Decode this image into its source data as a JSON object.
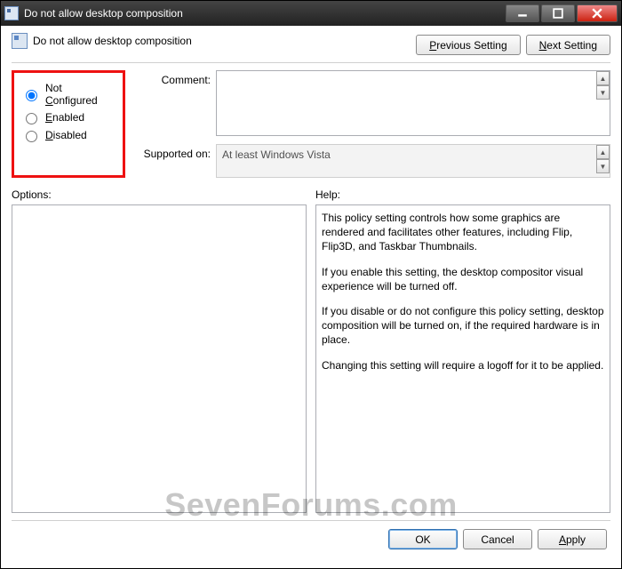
{
  "window": {
    "title": "Do not allow desktop composition"
  },
  "header": {
    "policy_name": "Do not allow desktop composition",
    "prev_button": "Previous Setting",
    "next_button": "Next Setting"
  },
  "state": {
    "selected": "not_configured",
    "not_configured_label": "Not Configured",
    "enabled_label": "Enabled",
    "disabled_label": "Disabled"
  },
  "fields": {
    "comment_label": "Comment:",
    "comment_value": "",
    "supported_label": "Supported on:",
    "supported_value": "At least Windows Vista"
  },
  "options": {
    "label": "Options:",
    "content": ""
  },
  "help": {
    "label": "Help:",
    "p1": "This policy setting controls how some graphics are rendered and facilitates other features, including Flip, Flip3D, and Taskbar Thumbnails.",
    "p2": "If you enable this setting, the desktop compositor visual experience will be turned off.",
    "p3": "If you disable or do not configure this policy setting, desktop composition will be turned on, if the required hardware is in place.",
    "p4": "Changing this setting will require a logoff for it to be applied."
  },
  "footer": {
    "ok": "OK",
    "cancel": "Cancel",
    "apply": "Apply"
  },
  "watermark": "SevenForums.com"
}
